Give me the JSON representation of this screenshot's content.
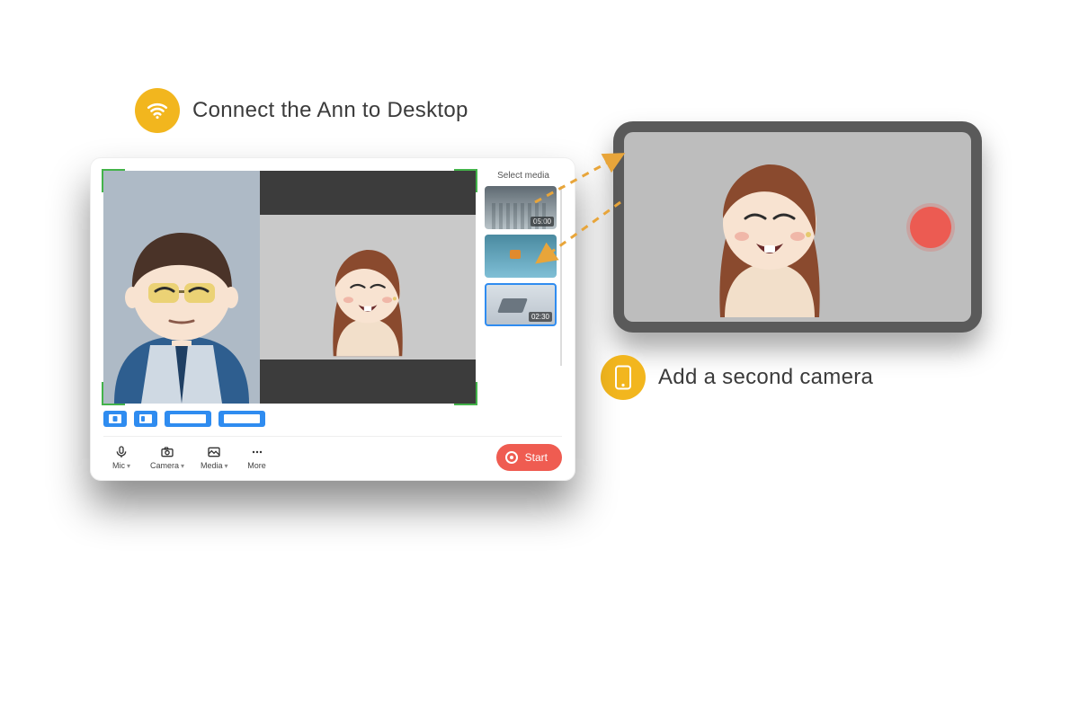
{
  "callouts": {
    "connect": "Connect the Ann to Desktop",
    "add_camera": "Add a second camera"
  },
  "app": {
    "media_title": "Select media",
    "thumbs": [
      {
        "duration": "05:00"
      },
      {
        "duration": ""
      },
      {
        "duration": "02:30"
      }
    ],
    "toolbar": {
      "mic": "Mic",
      "camera": "Camera",
      "media": "Media",
      "more": "More",
      "start": "Start"
    }
  },
  "colors": {
    "accent_yellow": "#f2b61e",
    "accent_red": "#ef5c51",
    "accent_blue": "#2f8cf0",
    "frame_green": "#43b34a"
  }
}
